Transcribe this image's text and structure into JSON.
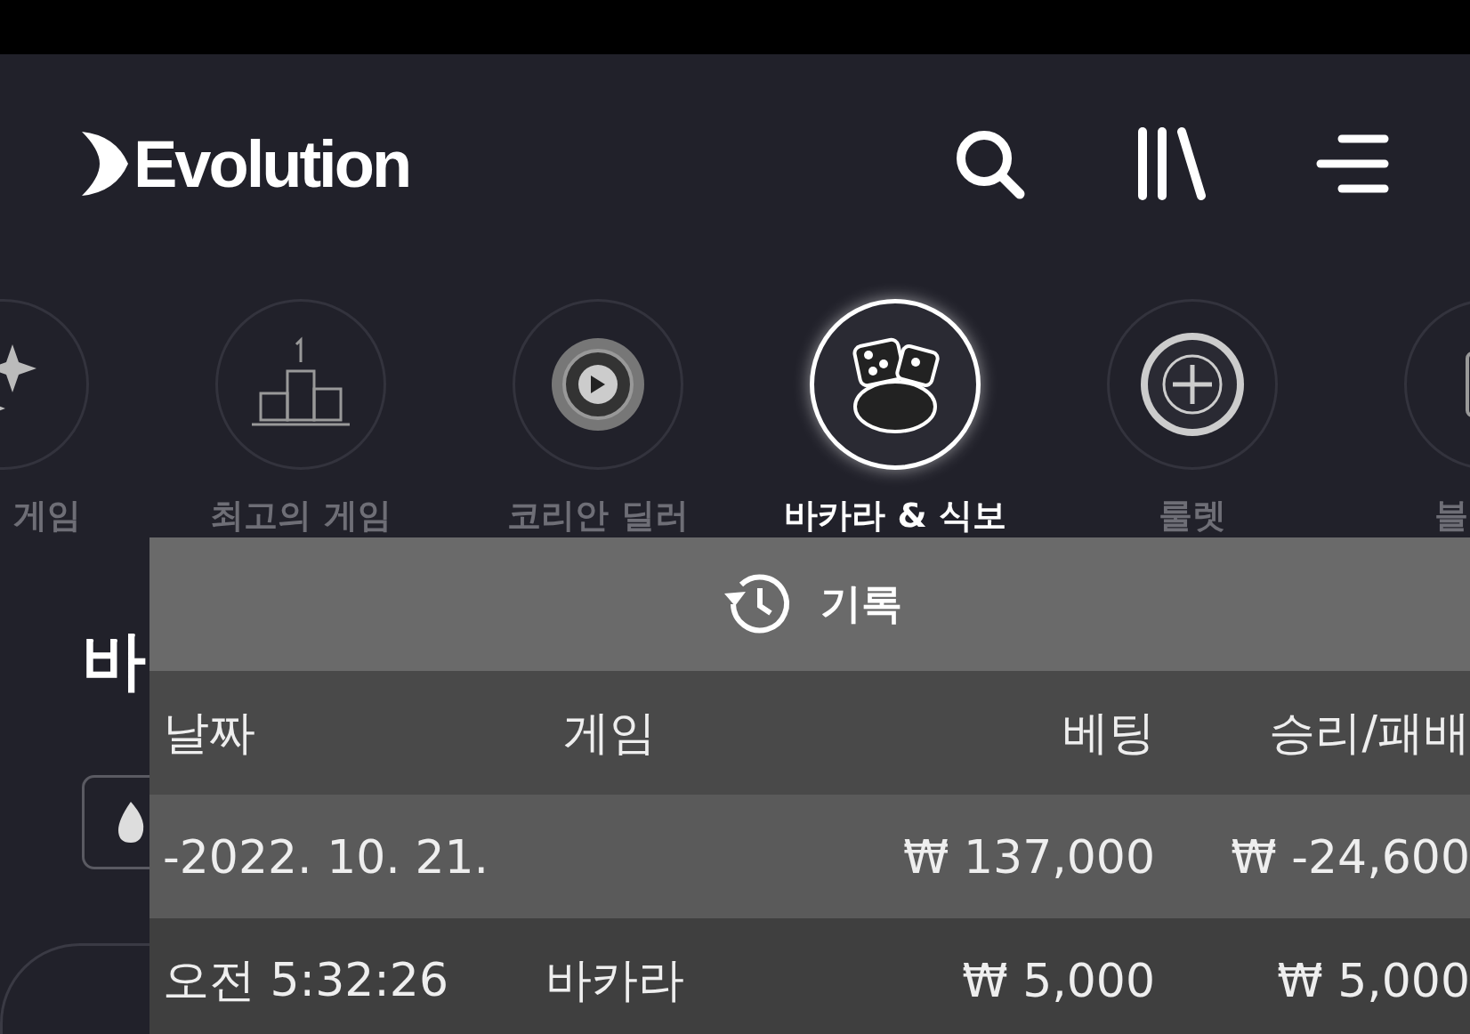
{
  "header": {
    "logo": "Evolution"
  },
  "categories": [
    {
      "label": "게임",
      "kind": "sparkles",
      "selected": false
    },
    {
      "label": "최고의 게임",
      "kind": "podium",
      "selected": false
    },
    {
      "label": "코리안 딜러",
      "kind": "chip",
      "selected": false
    },
    {
      "label": "바카라 & 식보",
      "kind": "dice",
      "selected": true
    },
    {
      "label": "룰렛",
      "kind": "roulette",
      "selected": false
    },
    {
      "label": "블",
      "kind": "card",
      "selected": false
    }
  ],
  "section": {
    "heading": "바"
  },
  "history": {
    "title": "기록",
    "columns": [
      "날짜",
      "게임",
      "베팅",
      "승리/패배"
    ],
    "rows": [
      {
        "date": "-2022. 10. 21.",
        "bet": "₩ 137,000",
        "result": "₩ -24,600"
      },
      {
        "date": "오전 5:32:26",
        "game": "바카라",
        "bet": "₩ 5,000",
        "result": "₩ 5,000"
      }
    ]
  }
}
